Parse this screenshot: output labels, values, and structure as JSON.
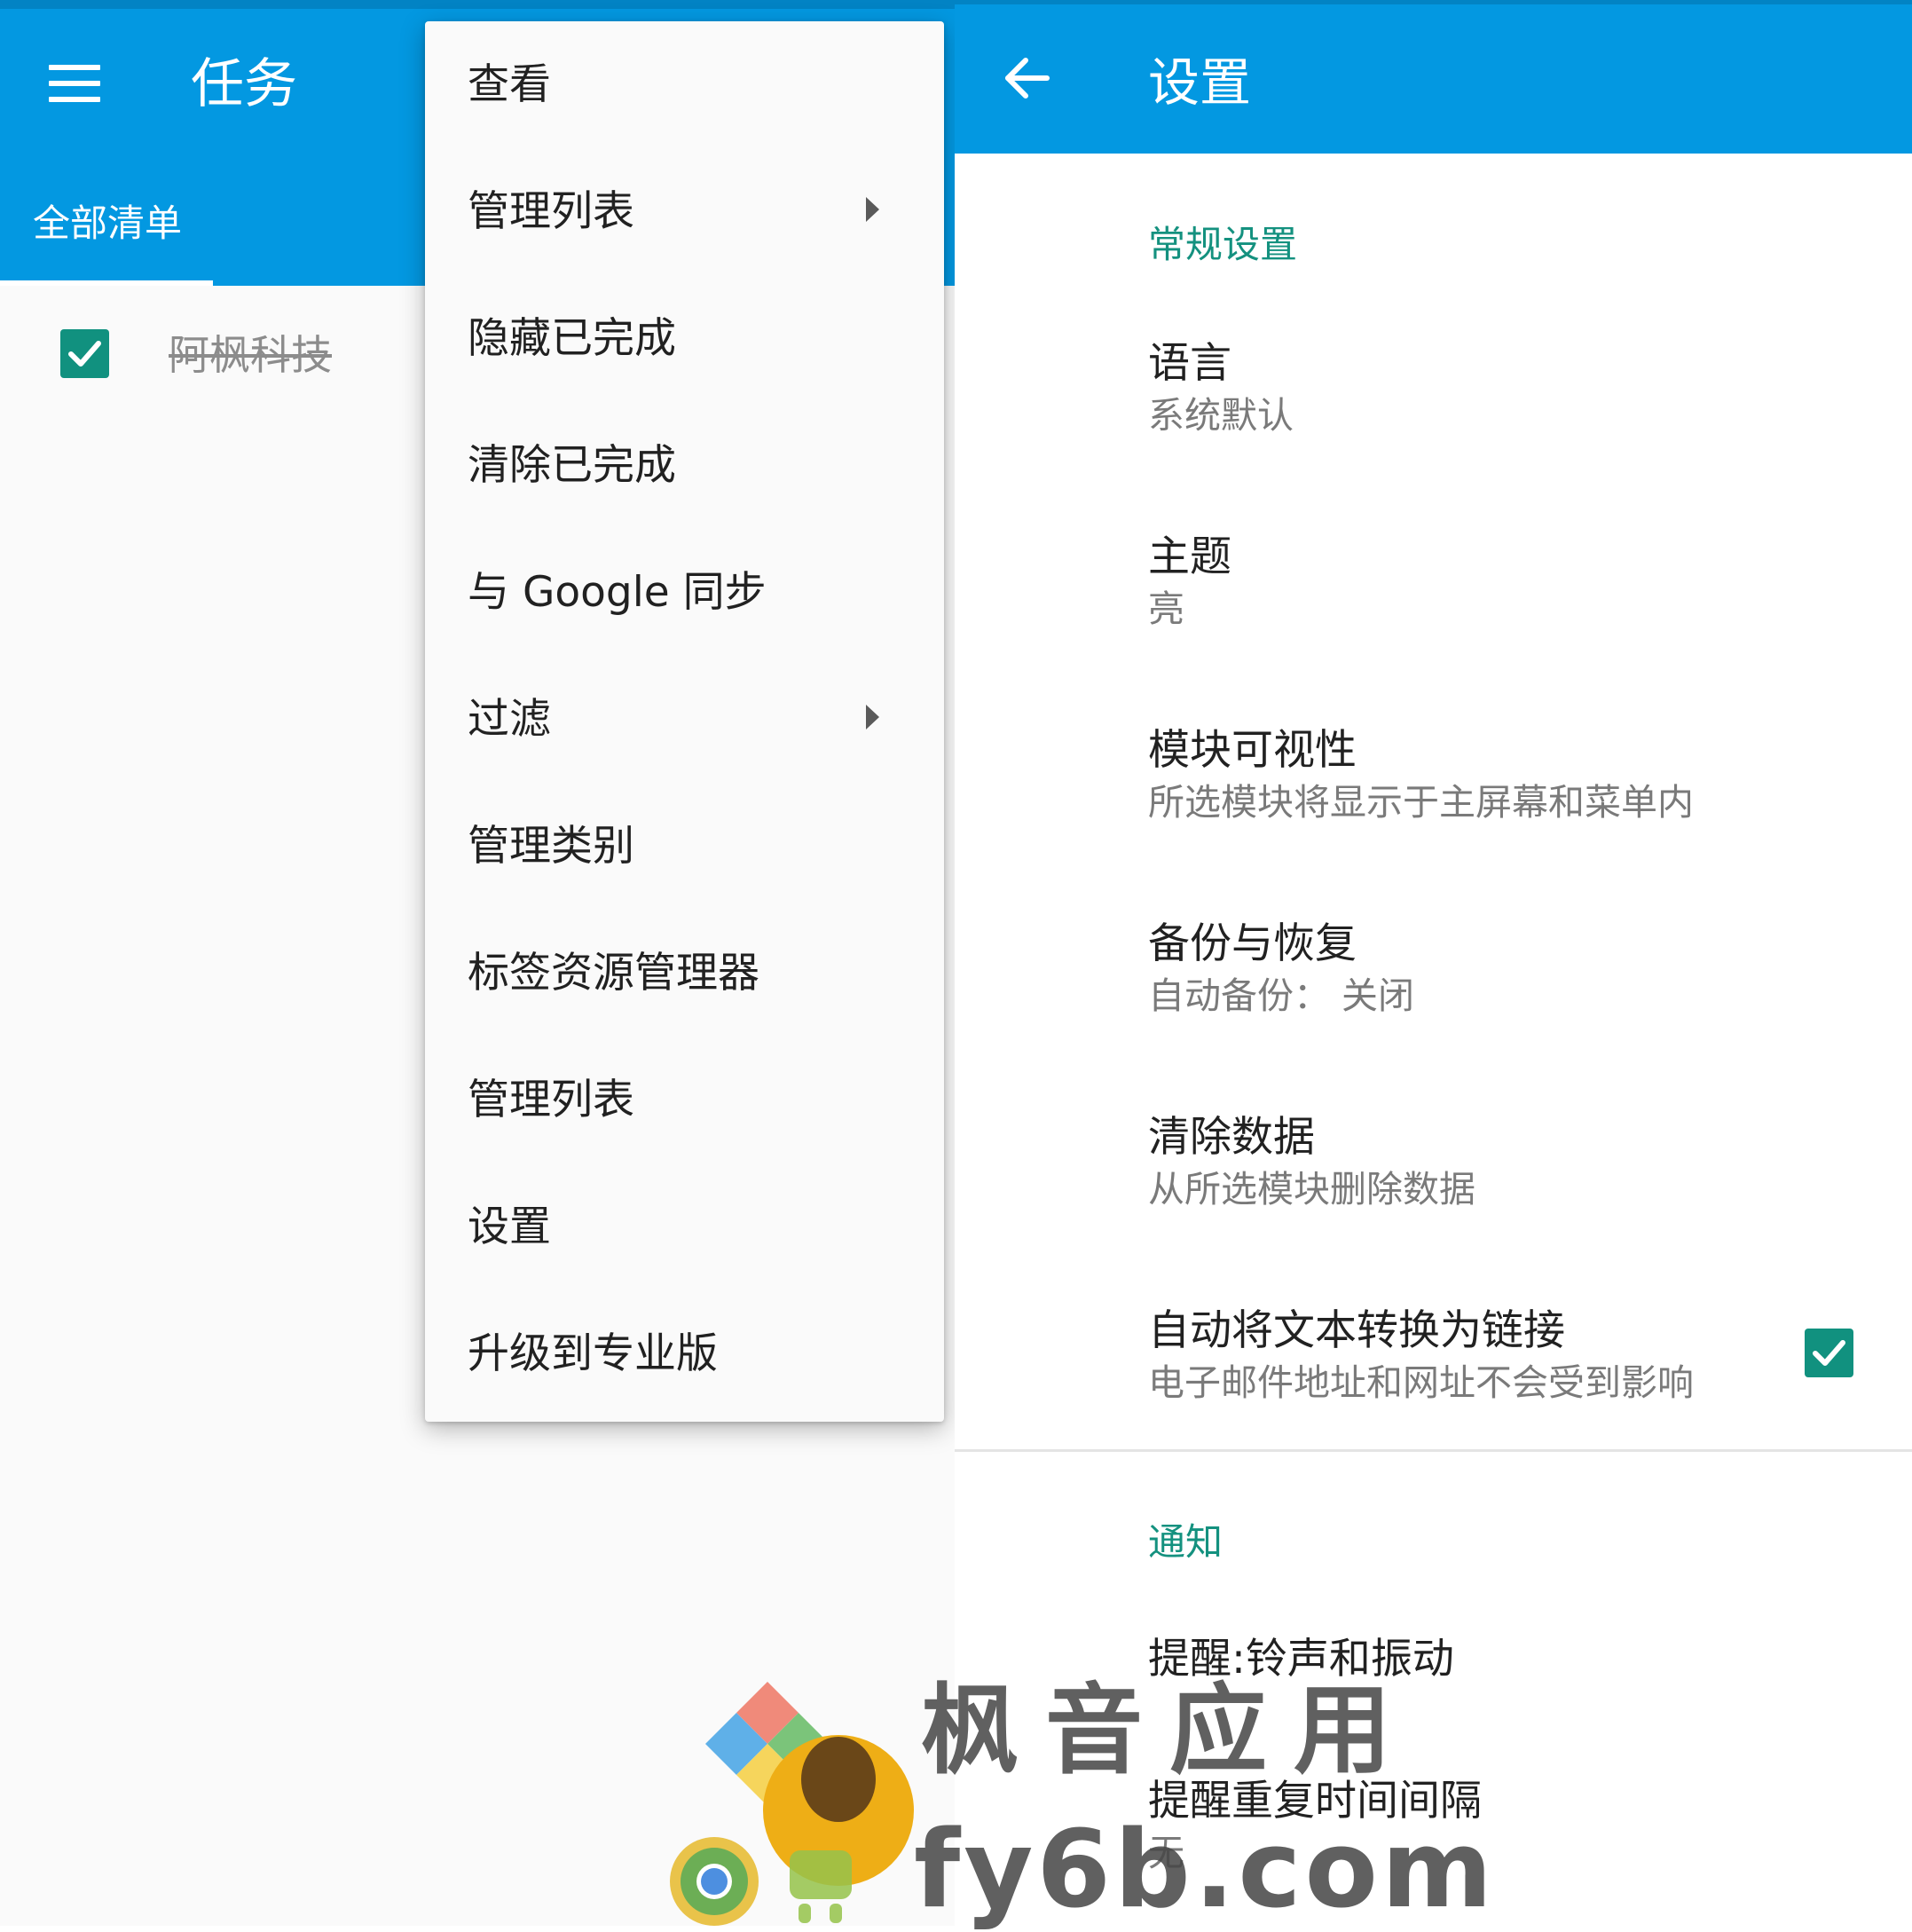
{
  "tasks_screen": {
    "title": "任务",
    "menu_icon": "hamburger-menu-icon",
    "tab_label": "全部清单",
    "task": {
      "label": "阿枫科技",
      "completed": true
    }
  },
  "overflow_menu": {
    "items": [
      {
        "label": "查看",
        "submenu": false
      },
      {
        "label": "管理列表",
        "submenu": true
      },
      {
        "label": "隐藏已完成",
        "submenu": false
      },
      {
        "label": "清除已完成",
        "submenu": false
      },
      {
        "label": "与 Google 同步",
        "submenu": false
      },
      {
        "label": "过滤",
        "submenu": true
      },
      {
        "label": "管理类别",
        "submenu": false
      },
      {
        "label": "标签资源管理器",
        "submenu": false
      },
      {
        "label": "管理列表",
        "submenu": false
      },
      {
        "label": "设置",
        "submenu": false
      },
      {
        "label": "升级到专业版",
        "submenu": false
      }
    ]
  },
  "settings_screen": {
    "title": "设置",
    "back_icon": "arrow-back-icon",
    "general_header": "常规设置",
    "prefs": [
      {
        "title": "语言",
        "summary": "系统默认"
      },
      {
        "title": "主题",
        "summary": "亮"
      },
      {
        "title": "模块可视性",
        "summary": "所选模块将显示于主屏幕和菜单内"
      },
      {
        "title": "备份与恢复",
        "summary": "自动备份： 关闭"
      },
      {
        "title": "清除数据",
        "summary": "从所选模块删除数据"
      },
      {
        "title": "自动将文本转换为链接",
        "summary": "电子邮件地址和网址不会受到影响",
        "checked": true
      }
    ],
    "notify_header": "通知",
    "notify_prefs": [
      {
        "title": "提醒:铃声和振动",
        "summary": ""
      },
      {
        "title": "提醒重复时间间隔",
        "summary": "无"
      }
    ]
  },
  "watermark": {
    "line1": "枫音应用",
    "line2": "fy6b.com"
  },
  "colors": {
    "app_bar": "#0398e1",
    "accent": "#14917f",
    "checkbox": "#11917f",
    "menu_bg": "#fafafa"
  }
}
